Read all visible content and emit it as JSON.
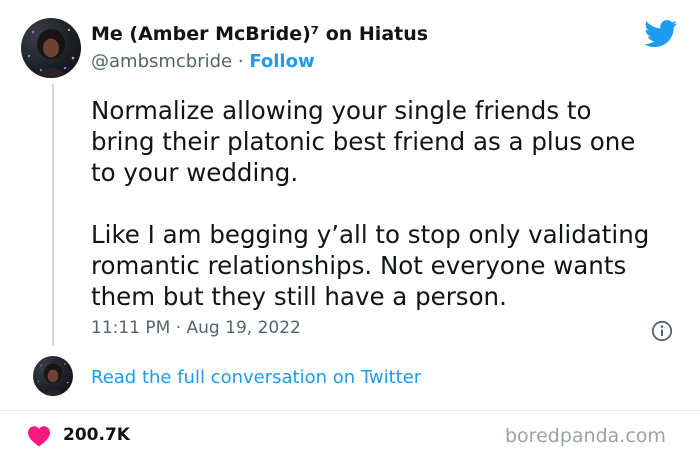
{
  "author": {
    "display_name": "Me (Amber McBride)⁷ on Hiatus",
    "handle": "@ambsmcbride",
    "separator": " · ",
    "follow_label": "Follow"
  },
  "tweet": {
    "text": "Normalize allowing your single friends to\nbring their platonic best friend as a plus one\nto your wedding.\n\nLike I am begging y’all to stop only validating\nromantic relationships. Not everyone wants\nthem but they still have a person.",
    "timestamp": "11:11 PM · Aug 19, 2022"
  },
  "conversation": {
    "link_label": "Read the full conversation on Twitter"
  },
  "engagement": {
    "likes": "200.7K"
  },
  "watermark": "boredpanda.com",
  "colors": {
    "accent": "#1d9bf0",
    "heart": "#f91880",
    "secondary_text": "#536471",
    "primary_text": "#0f1419",
    "watermark": "#9aa3a8"
  },
  "icons": {
    "brand": "twitter-bird-icon",
    "info": "info-icon",
    "like": "heart-icon"
  }
}
